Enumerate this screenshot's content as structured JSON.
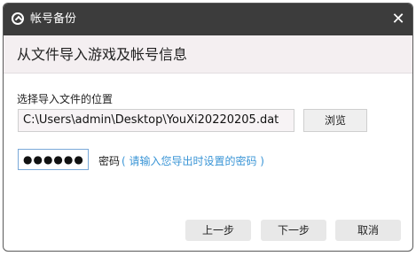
{
  "window": {
    "title": "帐号备份",
    "close_glyph": "✕",
    "header": "从文件导入游戏及帐号信息"
  },
  "file": {
    "label": "选择导入文件的位置",
    "path": "C:\\Users\\admin\\Desktop\\YouXi20220205.dat",
    "browse_label": "浏览"
  },
  "password": {
    "masked_value": "●●●●●●",
    "label": "密码",
    "hint": "( 请输入您导出时设置的密码 )"
  },
  "buttons": {
    "prev": "上一步",
    "next": "下一步",
    "cancel": "取消"
  },
  "colors": {
    "titlebar": "#3c3c3c",
    "header_band": "#f4eff1",
    "hint_text": "#3a95d6"
  }
}
